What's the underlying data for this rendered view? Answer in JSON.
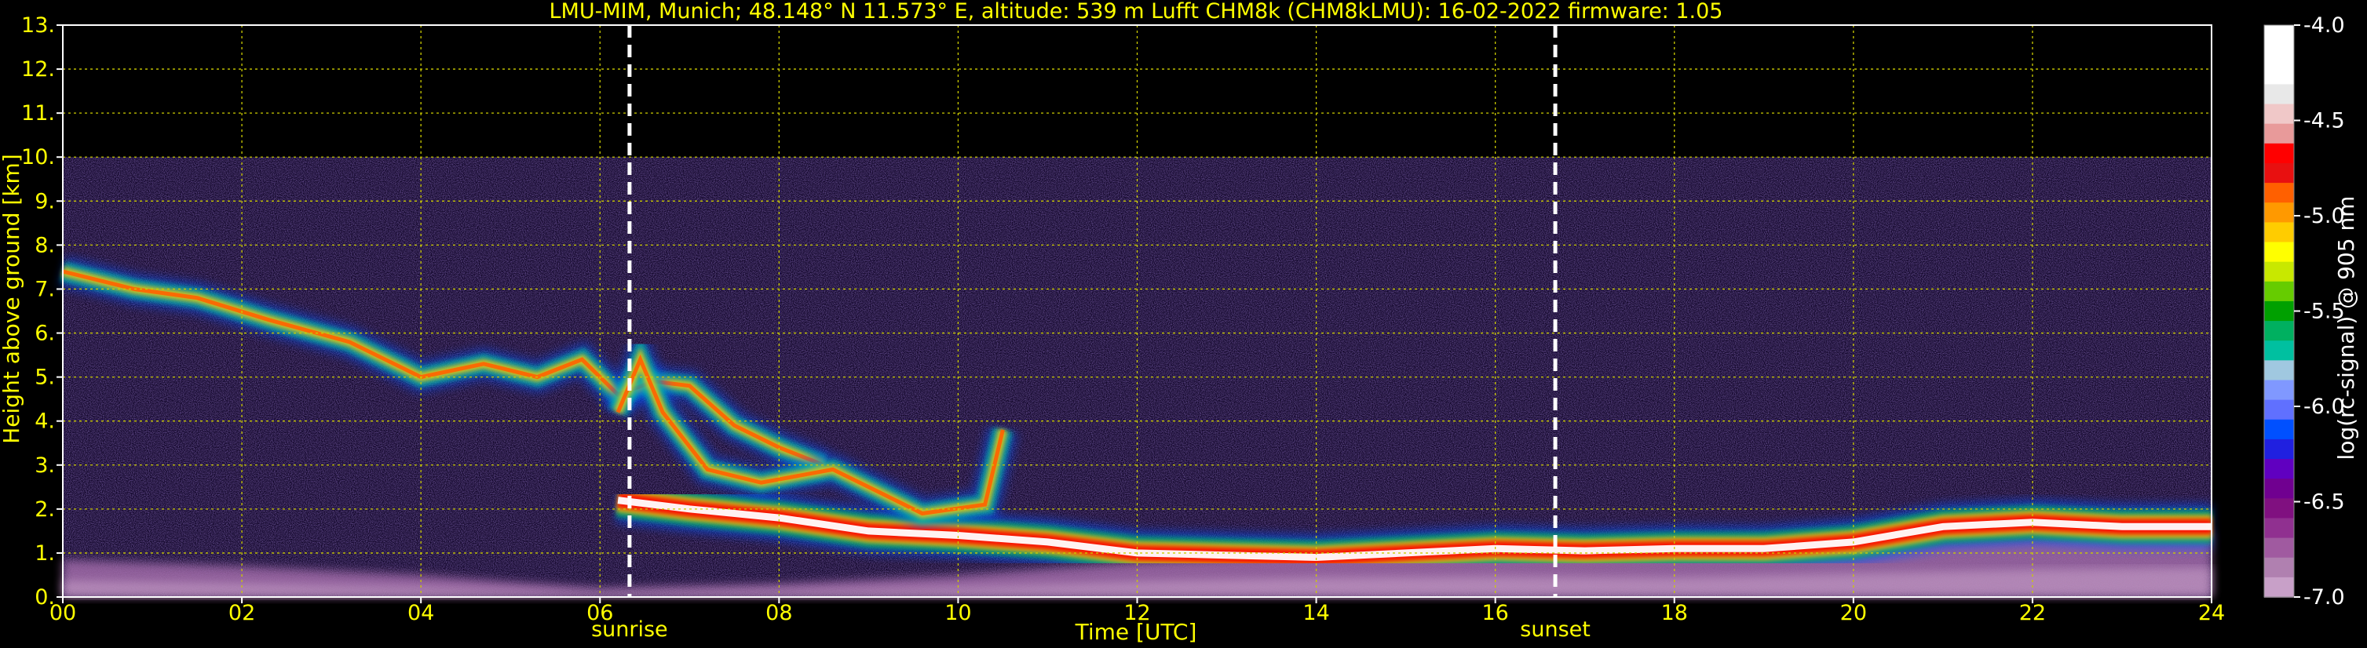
{
  "chart_data": {
    "type": "heatmap",
    "title": "LMU-MIM, Munich; 48.148° N 11.573° E, altitude: 539 m    Lufft CHM8k (CHM8kLMU): 16-02-2022    firmware: 1.05",
    "xlabel": "Time [UTC]",
    "ylabel": "Height above ground [km]",
    "xlim": [
      0,
      24
    ],
    "ylim": [
      0,
      13
    ],
    "x_ticks": [
      {
        "value": 0,
        "label": "00"
      },
      {
        "value": 2,
        "label": "02"
      },
      {
        "value": 4,
        "label": "04"
      },
      {
        "value": 6,
        "label": "06"
      },
      {
        "value": 8,
        "label": "08"
      },
      {
        "value": 10,
        "label": "10"
      },
      {
        "value": 12,
        "label": "12"
      },
      {
        "value": 14,
        "label": "14"
      },
      {
        "value": 16,
        "label": "16"
      },
      {
        "value": 18,
        "label": "18"
      },
      {
        "value": 20,
        "label": "20"
      },
      {
        "value": 22,
        "label": "22"
      },
      {
        "value": 24,
        "label": "24"
      }
    ],
    "y_ticks": [
      {
        "value": 0,
        "label": "0."
      },
      {
        "value": 1,
        "label": "1."
      },
      {
        "value": 2,
        "label": "2."
      },
      {
        "value": 3,
        "label": "3."
      },
      {
        "value": 4,
        "label": "4."
      },
      {
        "value": 5,
        "label": "5."
      },
      {
        "value": 6,
        "label": "6."
      },
      {
        "value": 7,
        "label": "7."
      },
      {
        "value": 8,
        "label": "8."
      },
      {
        "value": 9,
        "label": "9."
      },
      {
        "value": 10,
        "label": "10."
      },
      {
        "value": 11,
        "label": "11."
      },
      {
        "value": 12,
        "label": "12."
      },
      {
        "value": 13,
        "label": "13."
      }
    ],
    "grid": true,
    "grid_color": "#cccc00",
    "signal_max_height_km": 10,
    "events": [
      {
        "name": "sunrise",
        "x": 6.33
      },
      {
        "name": "sunset",
        "x": 16.67
      }
    ],
    "colorbar": {
      "label": "log(rc-signal) @ 905 nm",
      "range": [
        -7.0,
        -4.0
      ],
      "ticks": [
        {
          "value": -4.0,
          "label": "-4.0"
        },
        {
          "value": -4.5,
          "label": "-4.5"
        },
        {
          "value": -5.0,
          "label": "-5.0"
        },
        {
          "value": -5.5,
          "label": "-5.5"
        },
        {
          "value": -6.0,
          "label": "-6.0"
        },
        {
          "value": -6.5,
          "label": "-6.5"
        },
        {
          "value": -7.0,
          "label": "-7.0"
        }
      ],
      "colors": [
        "#ffffff",
        "#ffffff",
        "#ffffff",
        "#e8e8e8",
        "#f0c8c8",
        "#e89a9a",
        "#ff0000",
        "#e81010",
        "#ff6000",
        "#ff9900",
        "#ffcc00",
        "#ffff00",
        "#c8e800",
        "#66cc00",
        "#00a000",
        "#00b060",
        "#00c0a0",
        "#a0c8e0",
        "#8098ff",
        "#6070ff",
        "#0050ff",
        "#2020e0",
        "#6000c0",
        "#700090",
        "#801080",
        "#903090",
        "#a05aa0",
        "#b080b0",
        "#c8a0c8"
      ]
    },
    "layers": [
      {
        "name": "aerosol-layer",
        "points": [
          [
            0,
            0.85
          ],
          [
            2,
            0.7
          ],
          [
            4,
            0.5
          ],
          [
            6,
            0.2
          ],
          [
            8,
            0.3
          ],
          [
            10,
            0.5
          ],
          [
            12,
            0.8
          ],
          [
            14,
            1.0
          ],
          [
            16,
            1.05
          ],
          [
            18,
            1.0
          ],
          [
            20,
            1.2
          ],
          [
            22,
            1.4
          ],
          [
            24,
            1.5
          ]
        ]
      },
      {
        "name": "boundary-layer",
        "points": [
          [
            6.2,
            2.2
          ],
          [
            7,
            2.0
          ],
          [
            8,
            1.8
          ],
          [
            9,
            1.5
          ],
          [
            10,
            1.4
          ],
          [
            11,
            1.25
          ],
          [
            12,
            1.0
          ],
          [
            13,
            0.95
          ],
          [
            14,
            0.9
          ],
          [
            15,
            1.0
          ],
          [
            16,
            1.1
          ],
          [
            17,
            1.05
          ],
          [
            18,
            1.1
          ],
          [
            19,
            1.1
          ],
          [
            20,
            1.25
          ],
          [
            21,
            1.6
          ],
          [
            22,
            1.7
          ],
          [
            23,
            1.6
          ],
          [
            24,
            1.6
          ]
        ]
      },
      {
        "name": "cirrus-cloud",
        "points": [
          [
            0,
            7.4
          ],
          [
            0.8,
            7.0
          ],
          [
            1.5,
            6.8
          ],
          [
            2.3,
            6.3
          ],
          [
            3.2,
            5.8
          ],
          [
            4,
            5.0
          ],
          [
            4.7,
            5.3
          ],
          [
            5.3,
            5.0
          ],
          [
            5.8,
            5.4
          ],
          [
            6.2,
            4.6
          ],
          [
            6.6,
            4.9
          ],
          [
            7,
            4.8
          ],
          [
            7.5,
            3.9
          ],
          [
            8,
            3.4
          ],
          [
            8.5,
            3.0
          ]
        ]
      },
      {
        "name": "sunrise-cloud",
        "points": [
          [
            6.2,
            4.2
          ],
          [
            6.45,
            5.4
          ],
          [
            6.7,
            4.2
          ],
          [
            7.2,
            2.9
          ],
          [
            7.8,
            2.6
          ],
          [
            8.6,
            2.9
          ],
          [
            9.1,
            2.4
          ],
          [
            9.6,
            1.9
          ],
          [
            10.3,
            2.1
          ],
          [
            10.5,
            3.8
          ]
        ]
      }
    ]
  }
}
